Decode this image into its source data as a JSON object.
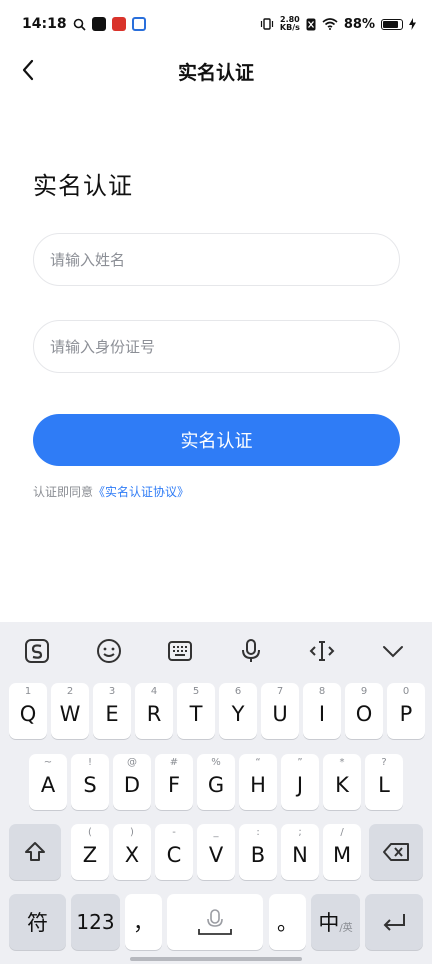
{
  "status_bar": {
    "time": "14:18",
    "net_speed_value": "2.80",
    "net_speed_unit": "KB/s",
    "battery_percent": "88%",
    "battery_level": 0.88
  },
  "header": {
    "title": "实名认证"
  },
  "main": {
    "heading": "实名认证",
    "name_placeholder": "请输入姓名",
    "id_placeholder": "请输入身份证号",
    "submit_label": "实名认证",
    "agreement_prefix": "认证即同意",
    "agreement_link": "《实名认证协议》"
  },
  "keyboard": {
    "toolbar_icons": [
      "sogou-logo-icon",
      "emoji-icon",
      "keyboard-icon",
      "microphone-icon",
      "text-cursor-icon",
      "collapse-icon"
    ],
    "row1": [
      {
        "hint": "1",
        "key": "Q"
      },
      {
        "hint": "2",
        "key": "W"
      },
      {
        "hint": "3",
        "key": "E"
      },
      {
        "hint": "4",
        "key": "R"
      },
      {
        "hint": "5",
        "key": "T"
      },
      {
        "hint": "6",
        "key": "Y"
      },
      {
        "hint": "7",
        "key": "U"
      },
      {
        "hint": "8",
        "key": "I"
      },
      {
        "hint": "9",
        "key": "O"
      },
      {
        "hint": "0",
        "key": "P"
      }
    ],
    "row2": [
      {
        "hint": "~",
        "key": "A"
      },
      {
        "hint": "!",
        "key": "S"
      },
      {
        "hint": "@",
        "key": "D"
      },
      {
        "hint": "#",
        "key": "F"
      },
      {
        "hint": "%",
        "key": "G"
      },
      {
        "hint": "“",
        "key": "H"
      },
      {
        "hint": "”",
        "key": "J"
      },
      {
        "hint": "*",
        "key": "K"
      },
      {
        "hint": "?",
        "key": "L"
      }
    ],
    "row3": [
      {
        "hint": "(",
        "key": "Z"
      },
      {
        "hint": ")",
        "key": "X"
      },
      {
        "hint": "-",
        "key": "C"
      },
      {
        "hint": "_",
        "key": "V"
      },
      {
        "hint": ":",
        "key": "B"
      },
      {
        "hint": ";",
        "key": "N"
      },
      {
        "hint": "/",
        "key": "M"
      }
    ],
    "symbol_key": "符",
    "number_key": "123",
    "comma_key": "，",
    "period_key": "。",
    "lang_key_main": "中",
    "lang_key_sub": "/英"
  }
}
